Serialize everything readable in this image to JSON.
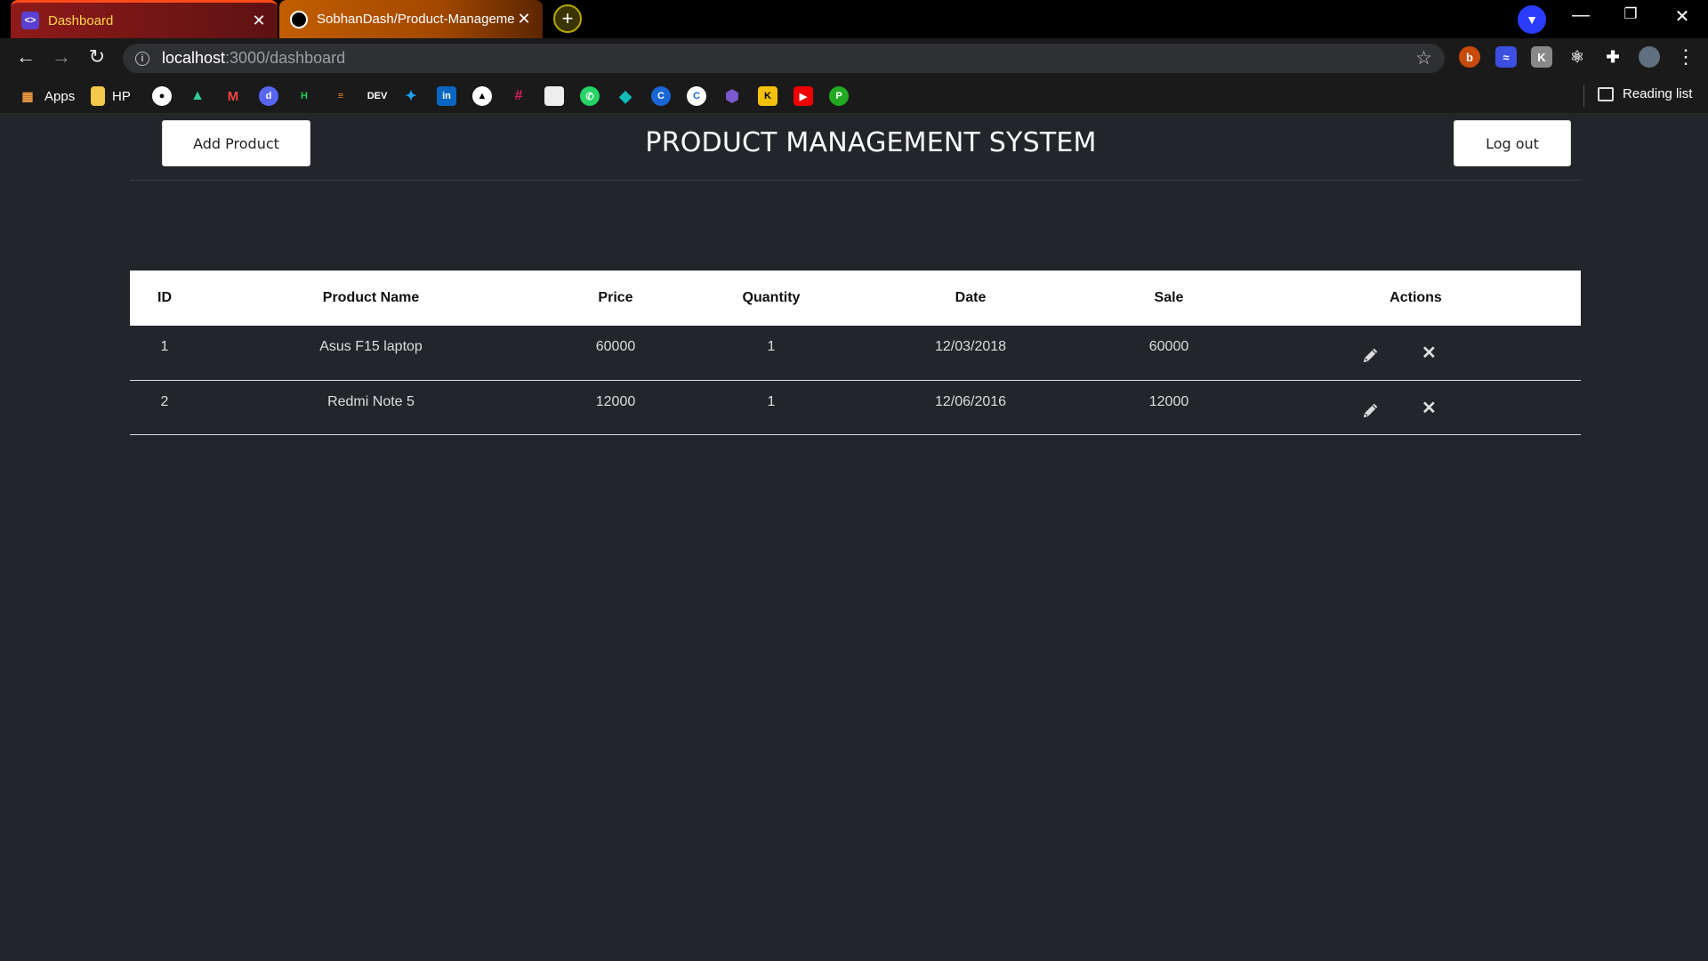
{
  "browser": {
    "tabs": [
      {
        "title": "Dashboard",
        "favicon": "app-logo-icon",
        "active": true
      },
      {
        "title": "SobhanDash/Product-Manageme",
        "favicon": "github-icon",
        "active": false
      }
    ],
    "new_tab_label": "+",
    "url_host": "localhost",
    "url_path": ":3000/dashboard",
    "bookmarks": [
      {
        "label": "Apps",
        "icon": "apps-grid-icon"
      },
      {
        "label": "HP",
        "icon": "folder-icon"
      },
      {
        "label": "",
        "icon": "github-icon"
      },
      {
        "label": "",
        "icon": "google-drive-icon"
      },
      {
        "label": "",
        "icon": "gmail-icon"
      },
      {
        "label": "",
        "icon": "discord-icon"
      },
      {
        "label": "",
        "icon": "hackerrank-icon"
      },
      {
        "label": "",
        "icon": "stackoverflow-icon"
      },
      {
        "label": "DEV",
        "icon": "dev-icon"
      },
      {
        "label": "",
        "icon": "twitter-icon"
      },
      {
        "label": "",
        "icon": "linkedin-icon"
      },
      {
        "label": "",
        "icon": "vercel-icon"
      },
      {
        "label": "",
        "icon": "slack-icon"
      },
      {
        "label": "",
        "icon": "bookmark-page-icon"
      },
      {
        "label": "",
        "icon": "whatsapp-icon"
      },
      {
        "label": "",
        "icon": "diamond-icon"
      },
      {
        "label": "",
        "icon": "codechef-icon"
      },
      {
        "label": "",
        "icon": "circle-c-icon"
      },
      {
        "label": "",
        "icon": "hexagon-icon"
      },
      {
        "label": "",
        "icon": "keep-icon"
      },
      {
        "label": "",
        "icon": "youtube-icon"
      },
      {
        "label": "",
        "icon": "shield-icon"
      }
    ],
    "reading_list": "Reading list"
  },
  "app": {
    "title": "PRODUCT MANAGEMENT SYSTEM",
    "add_button": "Add Product",
    "logout_button": "Log out",
    "table": {
      "columns": [
        "ID",
        "Product Name",
        "Price",
        "Quantity",
        "Date",
        "Sale",
        "Actions"
      ],
      "rows": [
        {
          "id": "1",
          "name": "Asus F15 laptop",
          "price": "60000",
          "quantity": "1",
          "date": "12/03/2018",
          "sale": "60000"
        },
        {
          "id": "2",
          "name": "Redmi Note 5",
          "price": "12000",
          "quantity": "1",
          "date": "12/06/2016",
          "sale": "12000"
        }
      ]
    }
  },
  "colors": {
    "background": "#22252a",
    "header_bg": "#ffffff",
    "text_light": "#dddddd"
  }
}
